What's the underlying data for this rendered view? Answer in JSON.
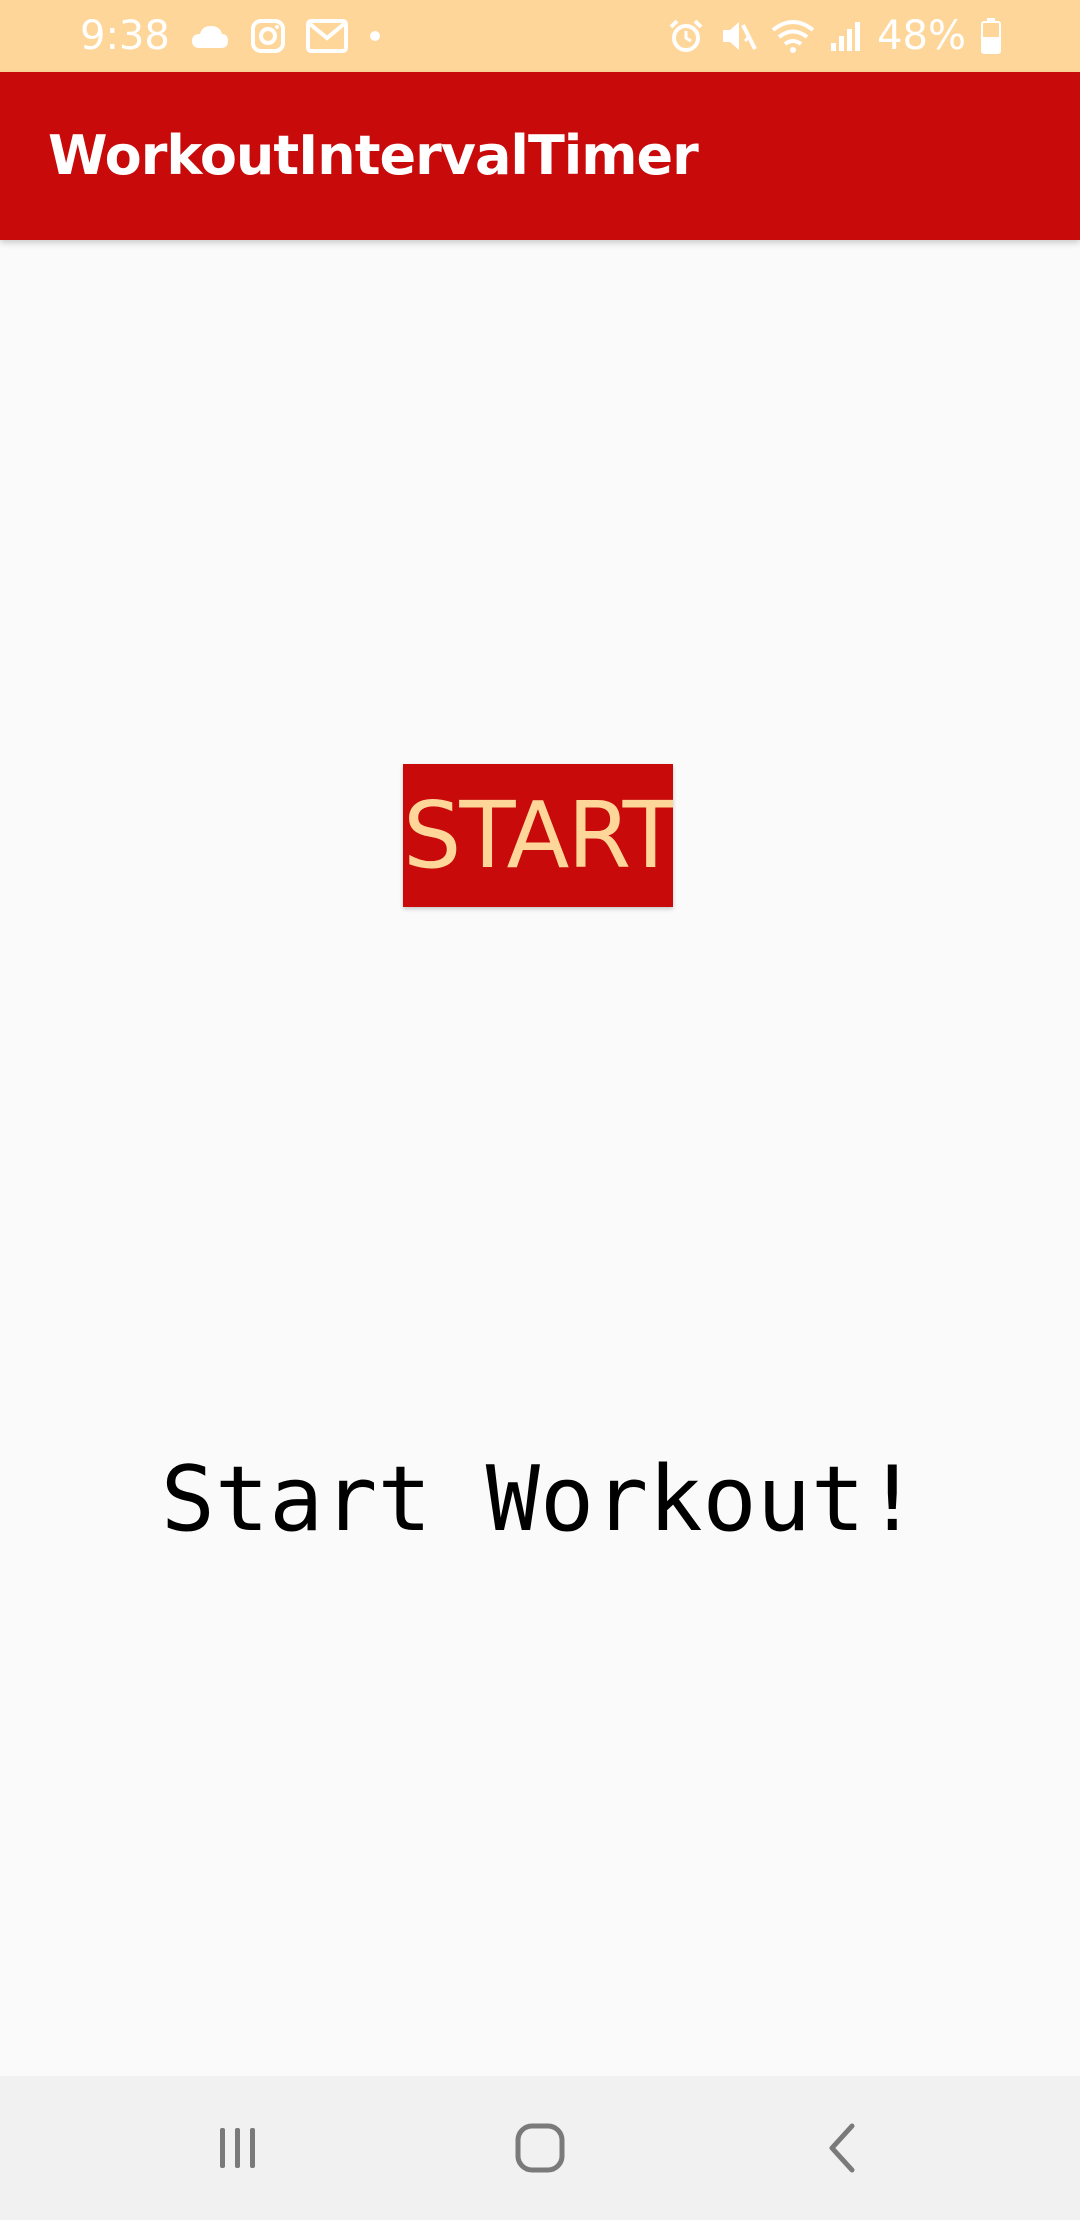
{
  "status_bar": {
    "time": "9:38",
    "battery": "48%",
    "left_icons": [
      "cloud-icon",
      "instagram-icon",
      "gmail-icon",
      "dot-icon"
    ],
    "right_icons": [
      "alarm-icon",
      "mute-icon",
      "wifi-icon",
      "signal-icon",
      "battery-icon"
    ]
  },
  "app_bar": {
    "title": "WorkoutIntervalTimer"
  },
  "main": {
    "start_label": "START",
    "message": "Start Workout!"
  },
  "nav_bar": {
    "buttons": [
      "recent-apps-icon",
      "home-icon",
      "back-icon"
    ]
  },
  "colors": {
    "primary": "#c80a0a",
    "accent": "#ffd699",
    "background": "#fafafa"
  }
}
